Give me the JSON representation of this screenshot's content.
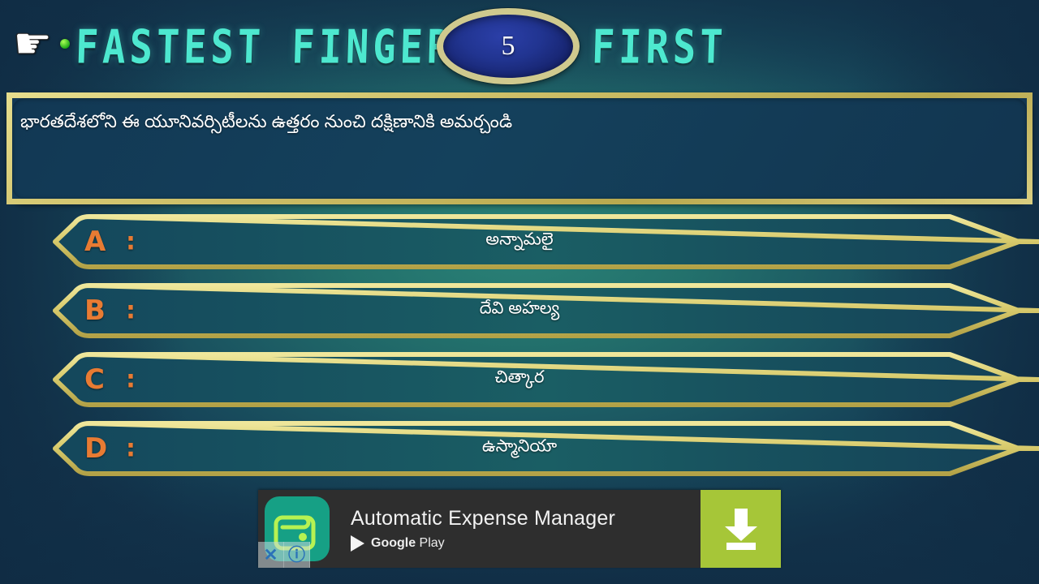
{
  "header": {
    "hand_icon": "pointing-hand-icon",
    "title_left": "FASTEST FINGER",
    "title_right": "FIRST",
    "timer_value": "5"
  },
  "question": {
    "text": "భారతదేశలోని ఈ యూనివర్సిటీలను ఉత్తరం నుంచి దక్షిణానికి అమర్చండి"
  },
  "options": [
    {
      "letter": "A",
      "colon": ":",
      "text": "అన్నామలై"
    },
    {
      "letter": "B",
      "colon": ":",
      "text": "దేవి అహల్య"
    },
    {
      "letter": "C",
      "colon": ":",
      "text": "చిత్కార"
    },
    {
      "letter": "D",
      "colon": ":",
      "text": "ఉస్మానియా"
    }
  ],
  "ad": {
    "icon_name": "wallet-icon",
    "title": "Automatic Expense Manager",
    "store_prefix": "Google",
    "store_suffix": " Play",
    "cta_icon": "download-icon",
    "close_label": "✕",
    "info_label": "ⓘ"
  },
  "colors": {
    "background_core": "#23716c",
    "background_edge": "#143c52",
    "title_cyan": "#4de8cf",
    "gold_border": "#cfc16a",
    "option_letter_orange": "#e87b33",
    "timer_navy": "#213490",
    "timer_ring": "#cfc98e",
    "ad_background": "#2e2e2e",
    "ad_cta_green": "#a6c638",
    "ad_icon_teal": "#16a085"
  }
}
